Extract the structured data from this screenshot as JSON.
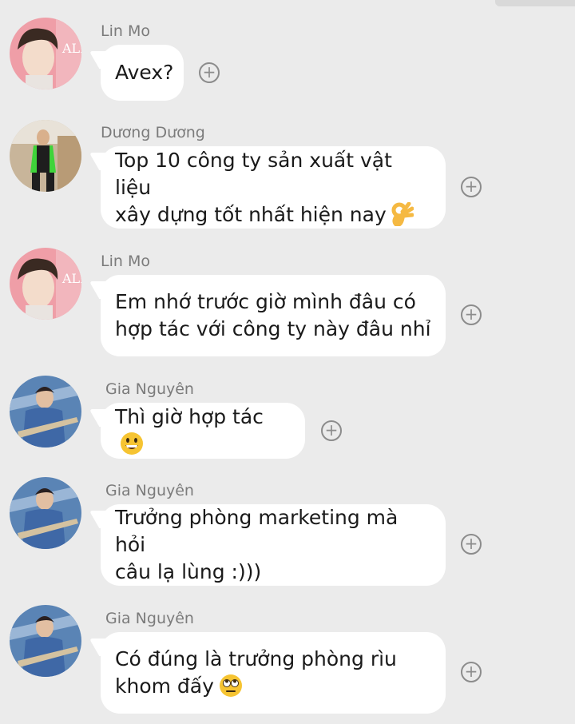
{
  "chat": {
    "messages": [
      {
        "sender": "Lin Mo",
        "avatar": "avatar-linmo",
        "text": "Avex?",
        "emoji": ""
      },
      {
        "sender": "Dương Dương",
        "avatar": "avatar-duongduong",
        "text": "Top 10 công ty sản xuất vật liệu\nxây dựng tốt nhất hiện nay",
        "emoji": "ok-hand-emoji"
      },
      {
        "sender": "Lin Mo",
        "avatar": "avatar-linmo",
        "text": "Em nhớ trước giờ mình đâu có\nhợp tác với công ty này đâu nhỉ",
        "emoji": ""
      },
      {
        "sender": "Gia Nguyên",
        "avatar": "avatar-gianguyen",
        "text": "Thì giờ hợp tác",
        "emoji": "grinning-emoji"
      },
      {
        "sender": "Gia Nguyên",
        "avatar": "avatar-gianguyen",
        "text": "Trưởng phòng marketing mà hỏi\ncâu lạ lùng :)))",
        "emoji": ""
      },
      {
        "sender": "Gia Nguyên",
        "avatar": "avatar-gianguyen",
        "text": "Có đúng là trưởng phòng rìu\nkhom đấy",
        "emoji": "eye-roll-emoji"
      }
    ],
    "add_reaction_icon": "plus-circle-icon"
  },
  "colors": {
    "background": "#ebebeb",
    "bubble": "#ffffff",
    "sender_text": "#7b7b7b",
    "icon": "#8c8c8c"
  }
}
